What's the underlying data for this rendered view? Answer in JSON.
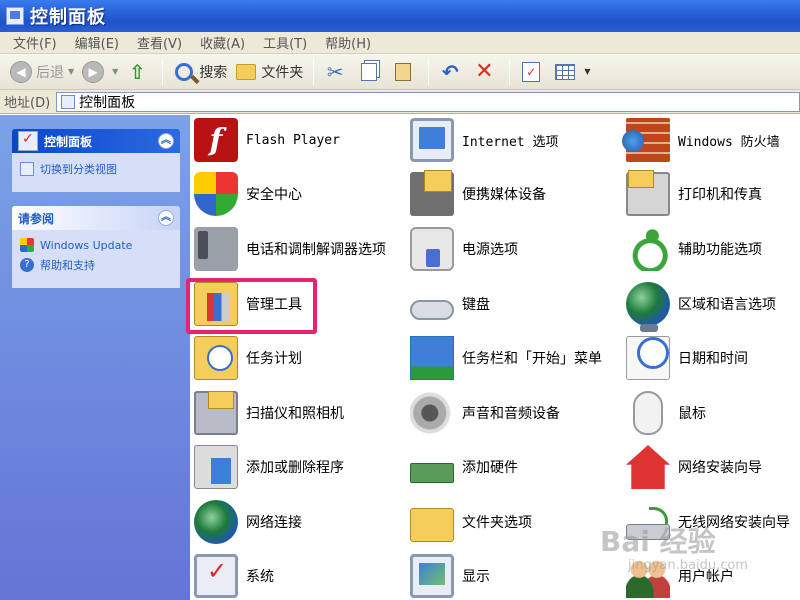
{
  "window": {
    "title": "控制面板"
  },
  "menu": [
    "文件(F)",
    "编辑(E)",
    "查看(V)",
    "收藏(A)",
    "工具(T)",
    "帮助(H)"
  ],
  "toolbar": {
    "back": "后退",
    "search": "搜索",
    "folders": "文件夹"
  },
  "address": {
    "label": "地址(D)",
    "value": "控制面板"
  },
  "sidebar": {
    "primary": {
      "title": "控制面板",
      "links": [
        {
          "label": "切换到分类视图",
          "icon": "switch-view-icon"
        }
      ]
    },
    "secondary": {
      "title": "请参阅",
      "links": [
        {
          "label": "Windows Update",
          "icon": "windows-flag-icon"
        },
        {
          "label": "帮助和支持",
          "icon": "help-icon"
        }
      ]
    }
  },
  "items": [
    {
      "label": "Flash Player",
      "icon": "flash-icon"
    },
    {
      "label": "Internet 选项",
      "icon": "internet-options-icon"
    },
    {
      "label": "Windows 防火墙",
      "icon": "firewall-icon"
    },
    {
      "label": "安全中心",
      "icon": "security-center-icon"
    },
    {
      "label": "便携媒体设备",
      "icon": "media-device-icon"
    },
    {
      "label": "打印机和传真",
      "icon": "printer-icon"
    },
    {
      "label": "电话和调制解调器选项",
      "icon": "phone-modem-icon"
    },
    {
      "label": "电源选项",
      "icon": "power-icon"
    },
    {
      "label": "辅助功能选项",
      "icon": "accessibility-icon"
    },
    {
      "label": "管理工具",
      "icon": "admin-tools-icon"
    },
    {
      "label": "键盘",
      "icon": "keyboard-icon"
    },
    {
      "label": "区域和语言选项",
      "icon": "region-language-icon"
    },
    {
      "label": "任务计划",
      "icon": "scheduled-tasks-icon"
    },
    {
      "label": "任务栏和「开始」菜单",
      "icon": "taskbar-icon"
    },
    {
      "label": "日期和时间",
      "icon": "date-time-icon"
    },
    {
      "label": "扫描仪和照相机",
      "icon": "scanner-camera-icon"
    },
    {
      "label": "声音和音频设备",
      "icon": "sound-icon"
    },
    {
      "label": "鼠标",
      "icon": "mouse-icon"
    },
    {
      "label": "添加或删除程序",
      "icon": "add-remove-programs-icon"
    },
    {
      "label": "添加硬件",
      "icon": "add-hardware-icon"
    },
    {
      "label": "网络安装向导",
      "icon": "network-setup-icon"
    },
    {
      "label": "网络连接",
      "icon": "network-connections-icon"
    },
    {
      "label": "文件夹选项",
      "icon": "folder-options-icon"
    },
    {
      "label": "无线网络安装向导",
      "icon": "wireless-setup-icon"
    },
    {
      "label": "系统",
      "icon": "system-icon"
    },
    {
      "label": "显示",
      "icon": "display-icon"
    },
    {
      "label": "用户帐户",
      "icon": "user-accounts-icon"
    }
  ],
  "watermark": {
    "main": "Bai 经验",
    "sub": "jingyan.baidu.com"
  },
  "colors": {
    "highlight": "#e8246f",
    "accent": "#215dc6"
  }
}
